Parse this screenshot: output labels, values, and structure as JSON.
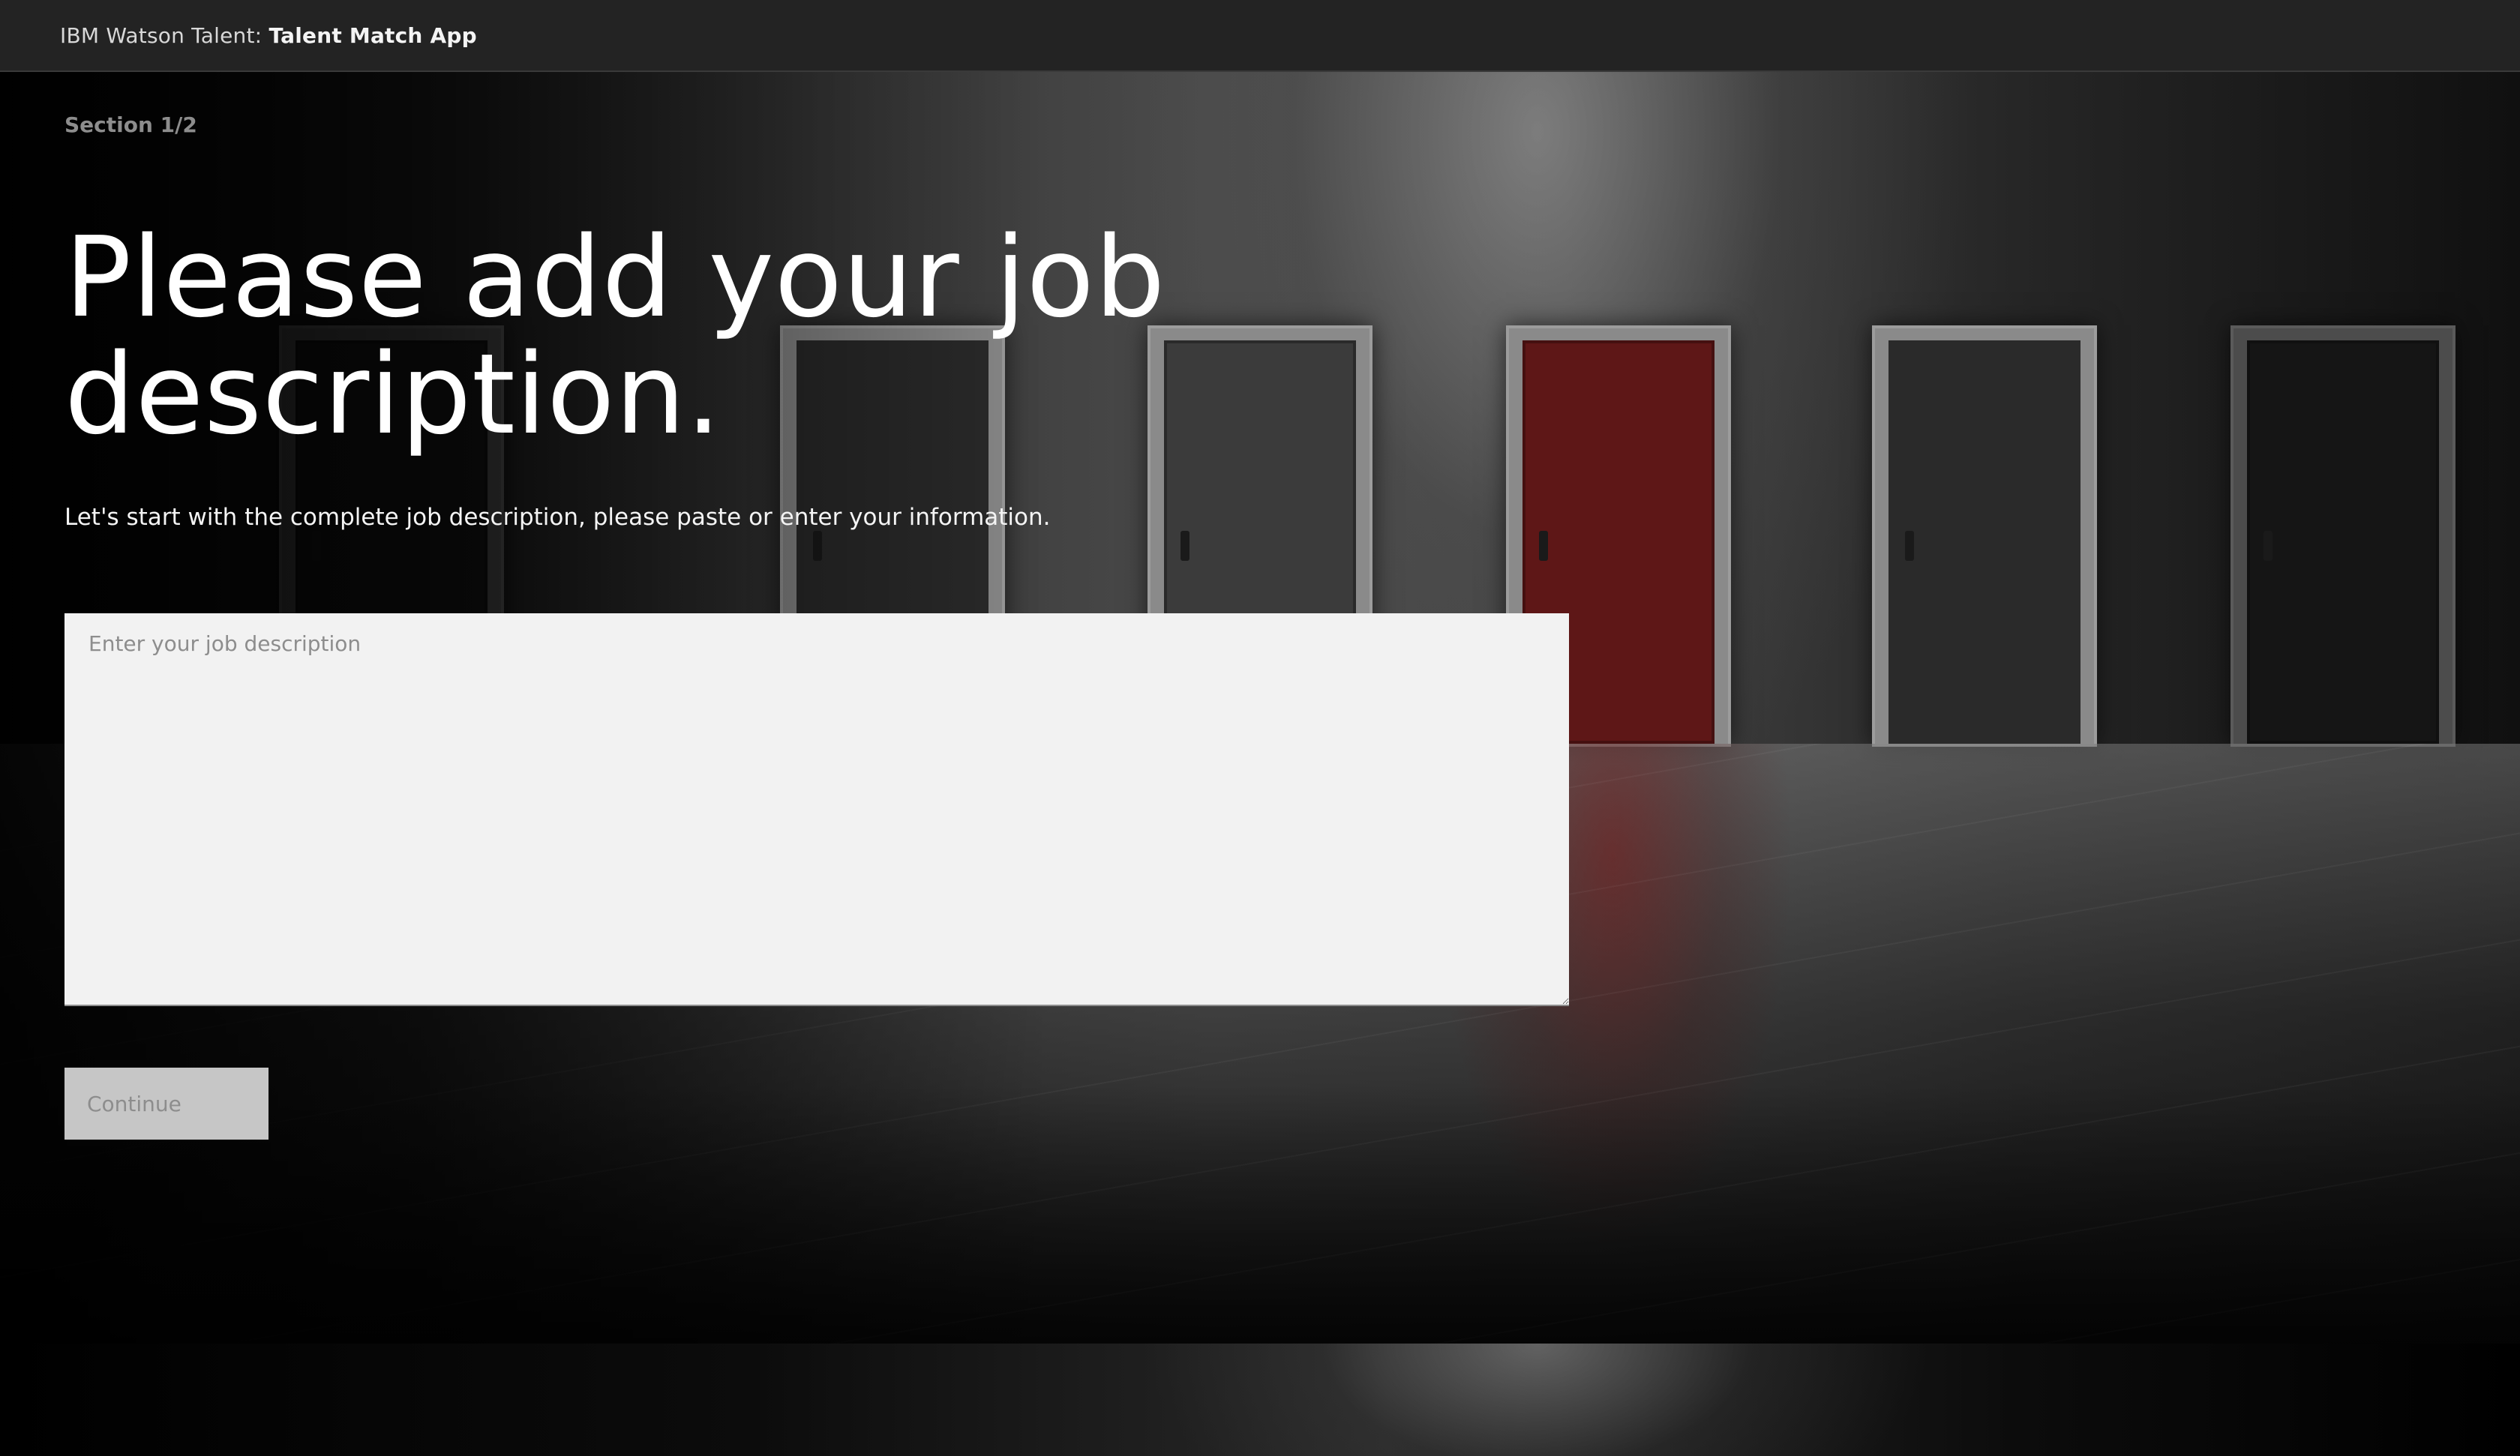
{
  "header": {
    "brand_prefix": "IBM Watson Talent:",
    "app_name": "Talent Match App"
  },
  "main": {
    "section_label": "Section 1/2",
    "title": "Please add your job description.",
    "subtitle": "Let's start with the complete job description, please paste or enter your information.",
    "job_description": {
      "placeholder": "Enter your job description",
      "value": ""
    },
    "continue_label": "Continue",
    "continue_disabled": true
  },
  "background": {
    "image_subject": "doors-hallway",
    "accent_door_color": "#5e1717"
  }
}
